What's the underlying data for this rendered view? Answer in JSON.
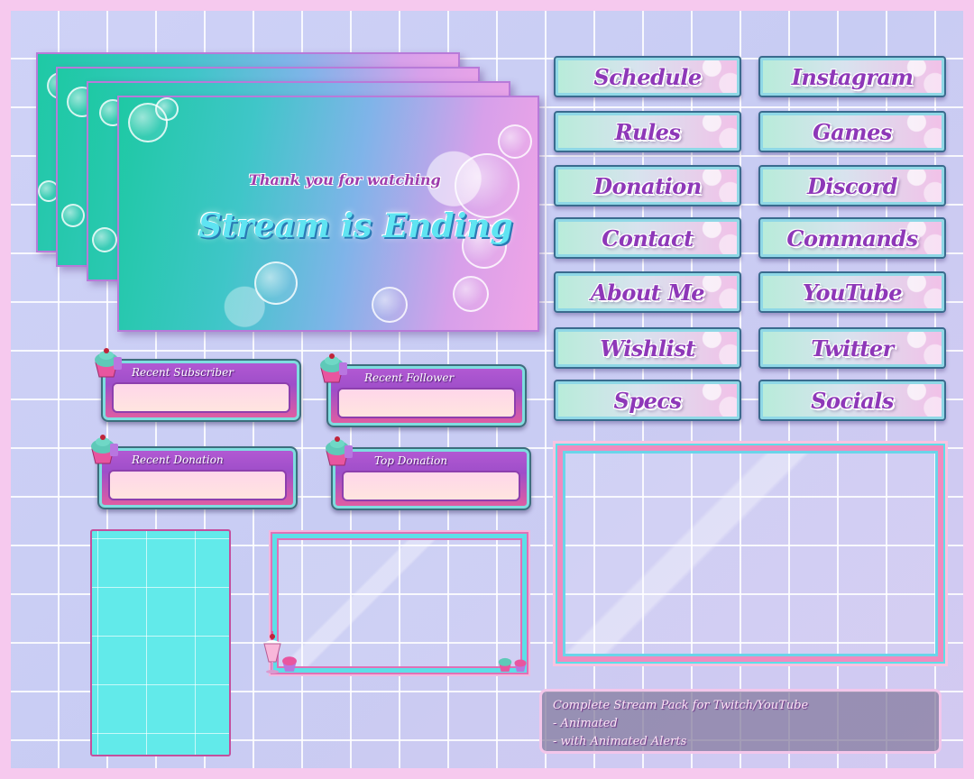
{
  "ending_screen": {
    "subtitle": "Thank you for watching",
    "title": "Stream is Ending"
  },
  "panels": {
    "left": [
      "Schedule",
      "Rules",
      "Donation",
      "Contact",
      "About Me",
      "Wishlist",
      "Specs"
    ],
    "right": [
      "Instagram",
      "Games",
      "Discord",
      "Commands",
      "YouTube",
      "Twitter",
      "Socials"
    ]
  },
  "alerts": {
    "recent_subscriber": "Recent Subscriber",
    "recent_follower": "Recent Follower",
    "recent_donation": "Recent Donation",
    "top_donation": "Top Donation"
  },
  "info": {
    "line1": "Complete Stream Pack for Twitch/YouTube",
    "line2": "- Animated",
    "line3": "- with Animated Alerts"
  },
  "colors": {
    "frame_border": "#f6c9ee",
    "accent_pink": "#f08bbf",
    "accent_cyan": "#5cdfe8",
    "text_purple": "#8e38b8"
  }
}
